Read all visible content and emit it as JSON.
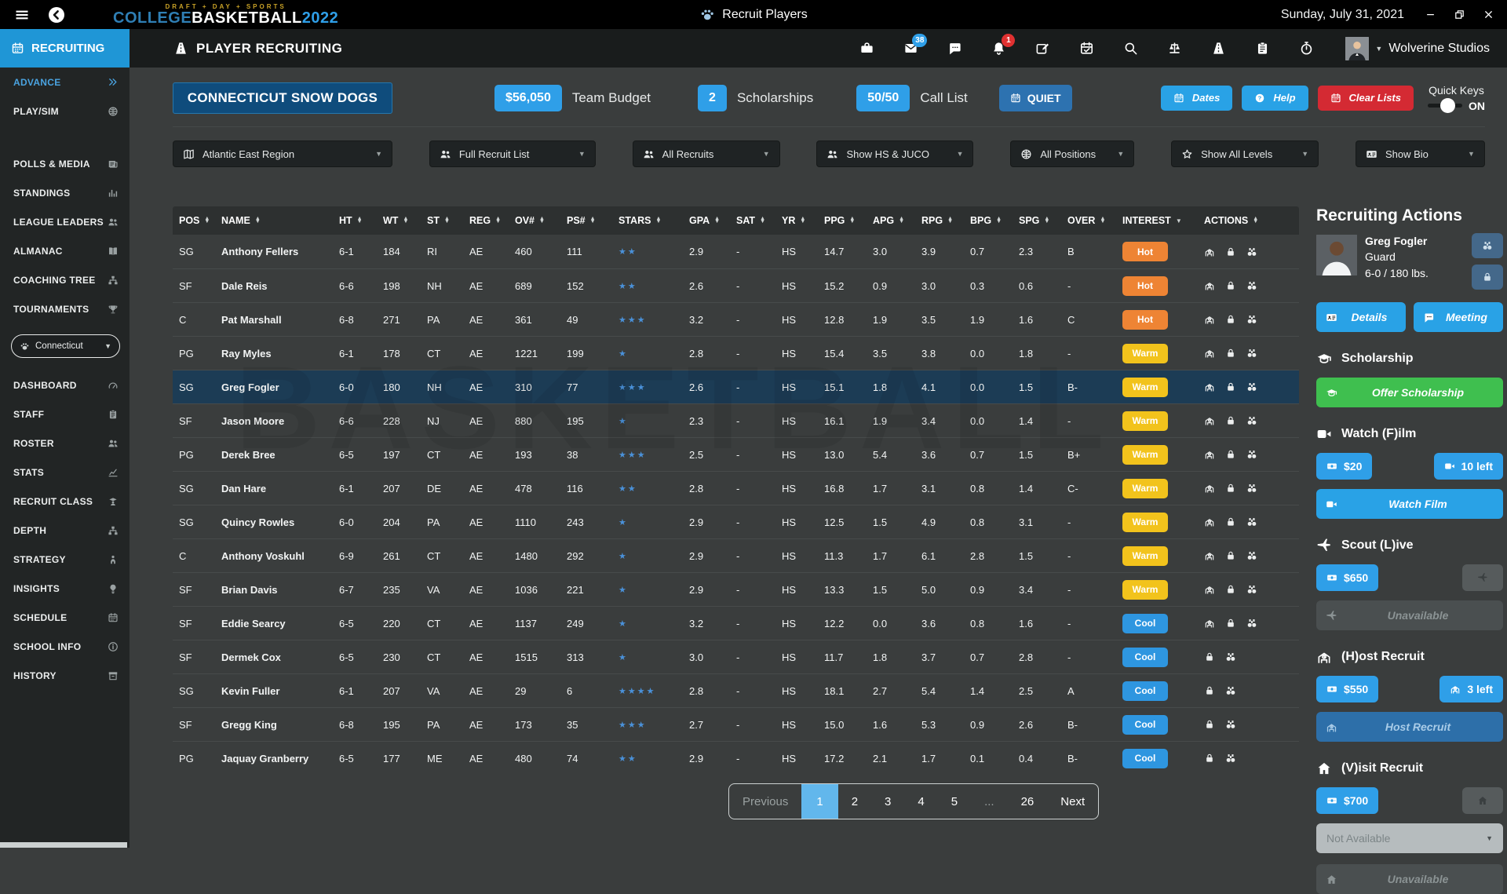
{
  "colors": {
    "accent_blue": "#2f9fe8",
    "button_blue": "#29a2e6",
    "tab_blue": "#1f96d6",
    "dark_navy": "#0f4c7c",
    "red": "#d42a33",
    "green": "#3fbf4f",
    "hot": "#ee8434",
    "warm": "#f2c31c",
    "cool": "#2e96e0",
    "star_blue": "#4a91d9",
    "selected_row": "#1c3c55",
    "active_page": "#62b7ec"
  },
  "titlebar": {
    "logo_kicker": "DRAFT + DAY + SPORTS",
    "logo_college": "COLLEGE",
    "logo_basketball": "BASKETBALL",
    "logo_year": "2022",
    "app_title": "Recruit Players",
    "date": "Sunday, July 31, 2021"
  },
  "appbar": {
    "tab_label": "RECRUITING",
    "page_title": "PLAYER RECRUITING",
    "toolbar": [
      {
        "name": "briefcase"
      },
      {
        "name": "mail",
        "badge": "38",
        "badge_color": "#2f9fe8"
      },
      {
        "name": "chat"
      },
      {
        "name": "bell",
        "badge": "1",
        "badge_color": "#e03131"
      },
      {
        "name": "edit"
      },
      {
        "name": "calendar-check"
      },
      {
        "name": "search"
      },
      {
        "name": "scales"
      },
      {
        "name": "road"
      },
      {
        "name": "clipboard"
      },
      {
        "name": "stopwatch"
      }
    ],
    "user_name": "Wolverine Studios"
  },
  "sidebar": {
    "items": [
      {
        "label": "ADVANCE",
        "icon": "chevrons",
        "active": true
      },
      {
        "label": "PLAY/SIM",
        "icon": "ball"
      },
      {
        "gap": true
      },
      {
        "label": "POLLS & MEDIA",
        "icon": "news"
      },
      {
        "label": "STANDINGS",
        "icon": "chartbar"
      },
      {
        "label": "LEAGUE LEADERS",
        "icon": "users"
      },
      {
        "label": "ALMANAC",
        "icon": "book"
      },
      {
        "label": "COACHING TREE",
        "icon": "sitemap"
      },
      {
        "label": "TOURNAMENTS",
        "icon": "trophy"
      },
      {
        "team_select": "Connecticut"
      },
      {
        "label": "DASHBOARD",
        "icon": "gauge"
      },
      {
        "label": "STAFF",
        "icon": "clipboard"
      },
      {
        "label": "ROSTER",
        "icon": "users"
      },
      {
        "label": "STATS",
        "icon": "chartline"
      },
      {
        "label": "RECRUIT CLASS",
        "icon": "usergrad"
      },
      {
        "label": "DEPTH",
        "icon": "sitemap"
      },
      {
        "label": "STRATEGY",
        "icon": "strategy"
      },
      {
        "label": "INSIGHTS",
        "icon": "bulb"
      },
      {
        "label": "SCHEDULE",
        "icon": "calendar"
      },
      {
        "label": "SCHOOL INFO",
        "icon": "info"
      },
      {
        "label": "HISTORY",
        "icon": "archive"
      }
    ]
  },
  "teambar": {
    "team_name": "CONNECTICUT SNOW DOGS",
    "budget_value": "$56,050",
    "budget_label": "Team Budget",
    "scholarships_value": "2",
    "scholarships_label": "Scholarships",
    "calllist_value": "50/50",
    "calllist_label": "Call List",
    "quiet_label": "QUIET",
    "dates_label": "Dates",
    "help_label": "Help",
    "clear_label": "Clear Lists",
    "quickkeys_label": "Quick Keys",
    "quickkeys_state": "ON"
  },
  "filters": [
    {
      "icon": "map",
      "label": "Atlantic East Region"
    },
    {
      "icon": "users",
      "label": "Full Recruit List"
    },
    {
      "icon": "users",
      "label": "All Recruits"
    },
    {
      "icon": "users",
      "label": "Show HS & JUCO"
    },
    {
      "icon": "ball",
      "label": "All Positions"
    },
    {
      "icon": "staro",
      "label": "Show All Levels"
    },
    {
      "icon": "idcard",
      "label": "Show Bio"
    }
  ],
  "table": {
    "watermark": "BASKETBALL",
    "columns": [
      {
        "key": "pos",
        "label": "POS"
      },
      {
        "key": "name",
        "label": "NAME"
      },
      {
        "key": "ht",
        "label": "HT"
      },
      {
        "key": "wt",
        "label": "WT"
      },
      {
        "key": "st",
        "label": "ST"
      },
      {
        "key": "reg",
        "label": "REG"
      },
      {
        "key": "ov",
        "label": "OV#"
      },
      {
        "key": "ps",
        "label": "PS#"
      },
      {
        "key": "stars",
        "label": "STARS"
      },
      {
        "key": "gpa",
        "label": "GPA"
      },
      {
        "key": "sat",
        "label": "SAT"
      },
      {
        "key": "yr",
        "label": "YR"
      },
      {
        "key": "ppg",
        "label": "PPG"
      },
      {
        "key": "apg",
        "label": "APG"
      },
      {
        "key": "rpg",
        "label": "RPG"
      },
      {
        "key": "bpg",
        "label": "BPG"
      },
      {
        "key": "spg",
        "label": "SPG"
      },
      {
        "key": "over",
        "label": "OVER"
      },
      {
        "key": "interest",
        "label": "INTEREST",
        "sort": "caret"
      },
      {
        "key": "actions",
        "label": "ACTIONS"
      }
    ],
    "rows": [
      {
        "pos": "SG",
        "name": "Anthony Fellers",
        "ht": "6-1",
        "wt": "184",
        "st": "RI",
        "reg": "AE",
        "ov": "460",
        "ps": "111",
        "stars": 2,
        "gpa": "2.9",
        "sat": "-",
        "yr": "HS",
        "ppg": "14.7",
        "apg": "3.0",
        "rpg": "3.9",
        "bpg": "0.7",
        "spg": "2.3",
        "over": "B",
        "interest": "Hot",
        "actions": [
          "host",
          "lock",
          "binoculars"
        ]
      },
      {
        "pos": "SF",
        "name": "Dale Reis",
        "ht": "6-6",
        "wt": "198",
        "st": "NH",
        "reg": "AE",
        "ov": "689",
        "ps": "152",
        "stars": 2,
        "gpa": "2.6",
        "sat": "-",
        "yr": "HS",
        "ppg": "15.2",
        "apg": "0.9",
        "rpg": "3.0",
        "bpg": "0.3",
        "spg": "0.6",
        "over": "-",
        "interest": "Hot",
        "actions": [
          "host",
          "lock",
          "binoculars"
        ]
      },
      {
        "pos": "C",
        "name": "Pat Marshall",
        "ht": "6-8",
        "wt": "271",
        "st": "PA",
        "reg": "AE",
        "ov": "361",
        "ps": "49",
        "stars": 3,
        "gpa": "3.2",
        "sat": "-",
        "yr": "HS",
        "ppg": "12.8",
        "apg": "1.9",
        "rpg": "3.5",
        "bpg": "1.9",
        "spg": "1.6",
        "over": "C",
        "interest": "Hot",
        "actions": [
          "host",
          "lock",
          "binoculars"
        ]
      },
      {
        "pos": "PG",
        "name": "Ray Myles",
        "ht": "6-1",
        "wt": "178",
        "st": "CT",
        "reg": "AE",
        "ov": "1221",
        "ps": "199",
        "stars": 1,
        "gpa": "2.8",
        "sat": "-",
        "yr": "HS",
        "ppg": "15.4",
        "apg": "3.5",
        "rpg": "3.8",
        "bpg": "0.0",
        "spg": "1.8",
        "over": "-",
        "interest": "Warm",
        "actions": [
          "host",
          "lock",
          "binoculars"
        ]
      },
      {
        "pos": "SG",
        "name": "Greg Fogler",
        "ht": "6-0",
        "wt": "180",
        "st": "NH",
        "reg": "AE",
        "ov": "310",
        "ps": "77",
        "stars": 3,
        "gpa": "2.6",
        "sat": "-",
        "yr": "HS",
        "ppg": "15.1",
        "apg": "1.8",
        "rpg": "4.1",
        "bpg": "0.0",
        "spg": "1.5",
        "over": "B-",
        "interest": "Warm",
        "actions": [
          "host",
          "lock",
          "binoculars"
        ],
        "selected": true
      },
      {
        "pos": "SF",
        "name": "Jason Moore",
        "ht": "6-6",
        "wt": "228",
        "st": "NJ",
        "reg": "AE",
        "ov": "880",
        "ps": "195",
        "stars": 1,
        "gpa": "2.3",
        "sat": "-",
        "yr": "HS",
        "ppg": "16.1",
        "apg": "1.9",
        "rpg": "3.4",
        "bpg": "0.0",
        "spg": "1.4",
        "over": "-",
        "interest": "Warm",
        "actions": [
          "host",
          "lock",
          "binoculars"
        ]
      },
      {
        "pos": "PG",
        "name": "Derek Bree",
        "ht": "6-5",
        "wt": "197",
        "st": "CT",
        "reg": "AE",
        "ov": "193",
        "ps": "38",
        "stars": 3,
        "gpa": "2.5",
        "sat": "-",
        "yr": "HS",
        "ppg": "13.0",
        "apg": "5.4",
        "rpg": "3.6",
        "bpg": "0.7",
        "spg": "1.5",
        "over": "B+",
        "interest": "Warm",
        "actions": [
          "host",
          "lock",
          "binoculars"
        ]
      },
      {
        "pos": "SG",
        "name": "Dan Hare",
        "ht": "6-1",
        "wt": "207",
        "st": "DE",
        "reg": "AE",
        "ov": "478",
        "ps": "116",
        "stars": 2,
        "gpa": "2.8",
        "sat": "-",
        "yr": "HS",
        "ppg": "16.8",
        "apg": "1.7",
        "rpg": "3.1",
        "bpg": "0.8",
        "spg": "1.4",
        "over": "C-",
        "interest": "Warm",
        "actions": [
          "host",
          "lock",
          "binoculars"
        ]
      },
      {
        "pos": "SG",
        "name": "Quincy Rowles",
        "ht": "6-0",
        "wt": "204",
        "st": "PA",
        "reg": "AE",
        "ov": "1110",
        "ps": "243",
        "stars": 1,
        "gpa": "2.9",
        "sat": "-",
        "yr": "HS",
        "ppg": "12.5",
        "apg": "1.5",
        "rpg": "4.9",
        "bpg": "0.8",
        "spg": "3.1",
        "over": "-",
        "interest": "Warm",
        "actions": [
          "host",
          "lock",
          "binoculars"
        ]
      },
      {
        "pos": "C",
        "name": "Anthony Voskuhl",
        "ht": "6-9",
        "wt": "261",
        "st": "CT",
        "reg": "AE",
        "ov": "1480",
        "ps": "292",
        "stars": 1,
        "gpa": "2.9",
        "sat": "-",
        "yr": "HS",
        "ppg": "11.3",
        "apg": "1.7",
        "rpg": "6.1",
        "bpg": "2.8",
        "spg": "1.5",
        "over": "-",
        "interest": "Warm",
        "actions": [
          "host",
          "lock",
          "binoculars"
        ]
      },
      {
        "pos": "SF",
        "name": "Brian Davis",
        "ht": "6-7",
        "wt": "235",
        "st": "VA",
        "reg": "AE",
        "ov": "1036",
        "ps": "221",
        "stars": 1,
        "gpa": "2.9",
        "sat": "-",
        "yr": "HS",
        "ppg": "13.3",
        "apg": "1.5",
        "rpg": "5.0",
        "bpg": "0.9",
        "spg": "3.4",
        "over": "-",
        "interest": "Warm",
        "actions": [
          "host",
          "lock",
          "binoculars"
        ]
      },
      {
        "pos": "SF",
        "name": "Eddie Searcy",
        "ht": "6-5",
        "wt": "220",
        "st": "CT",
        "reg": "AE",
        "ov": "1137",
        "ps": "249",
        "stars": 1,
        "gpa": "3.2",
        "sat": "-",
        "yr": "HS",
        "ppg": "12.2",
        "apg": "0.0",
        "rpg": "3.6",
        "bpg": "0.8",
        "spg": "1.6",
        "over": "-",
        "interest": "Cool",
        "actions": [
          "host",
          "lock",
          "binoculars"
        ]
      },
      {
        "pos": "SF",
        "name": "Dermek Cox",
        "ht": "6-5",
        "wt": "230",
        "st": "CT",
        "reg": "AE",
        "ov": "1515",
        "ps": "313",
        "stars": 1,
        "gpa": "3.0",
        "sat": "-",
        "yr": "HS",
        "ppg": "11.7",
        "apg": "1.8",
        "rpg": "3.7",
        "bpg": "0.7",
        "spg": "2.8",
        "over": "-",
        "interest": "Cool",
        "actions": [
          "lock",
          "binoculars"
        ]
      },
      {
        "pos": "SG",
        "name": "Kevin Fuller",
        "ht": "6-1",
        "wt": "207",
        "st": "VA",
        "reg": "AE",
        "ov": "29",
        "ps": "6",
        "stars": 4,
        "gpa": "2.8",
        "sat": "-",
        "yr": "HS",
        "ppg": "18.1",
        "apg": "2.7",
        "rpg": "5.4",
        "bpg": "1.4",
        "spg": "2.5",
        "over": "A",
        "interest": "Cool",
        "actions": [
          "lock",
          "binoculars"
        ]
      },
      {
        "pos": "SF",
        "name": "Gregg King",
        "ht": "6-8",
        "wt": "195",
        "st": "PA",
        "reg": "AE",
        "ov": "173",
        "ps": "35",
        "stars": 3,
        "gpa": "2.7",
        "sat": "-",
        "yr": "HS",
        "ppg": "15.0",
        "apg": "1.6",
        "rpg": "5.3",
        "bpg": "0.9",
        "spg": "2.6",
        "over": "B-",
        "interest": "Cool",
        "actions": [
          "lock",
          "binoculars"
        ]
      },
      {
        "pos": "PG",
        "name": "Jaquay Granberry",
        "ht": "6-5",
        "wt": "177",
        "st": "ME",
        "reg": "AE",
        "ov": "480",
        "ps": "74",
        "stars": 2,
        "gpa": "2.9",
        "sat": "-",
        "yr": "HS",
        "ppg": "17.2",
        "apg": "2.1",
        "rpg": "1.7",
        "bpg": "0.1",
        "spg": "0.4",
        "over": "B-",
        "interest": "Cool",
        "actions": [
          "lock",
          "binoculars"
        ]
      }
    ]
  },
  "pagination": {
    "previous": "Previous",
    "pages": [
      "1",
      "2",
      "3",
      "4",
      "5",
      "...",
      "26"
    ],
    "active_page": "1",
    "next": "Next"
  },
  "panel": {
    "title": "Recruiting Actions",
    "player": {
      "name": "Greg Fogler",
      "position": "Guard",
      "size": "6-0 / 180 lbs."
    },
    "details_label": "Details",
    "meeting_label": "Meeting",
    "scholarship": {
      "header": "Scholarship",
      "button": "Offer Scholarship"
    },
    "film": {
      "header": "Watch (F)ilm",
      "cost": "$20",
      "remaining": "10 left",
      "button": "Watch Film"
    },
    "scout": {
      "header": "Scout (L)ive",
      "cost": "$650",
      "button": "Unavailable"
    },
    "host": {
      "header": "(H)ost Recruit",
      "cost": "$550",
      "remaining": "3 left",
      "button": "Host Recruit"
    },
    "visit": {
      "header": "(V)isit Recruit",
      "cost": "$700",
      "dropdown": "Not Available",
      "button": "Unavailable"
    }
  }
}
